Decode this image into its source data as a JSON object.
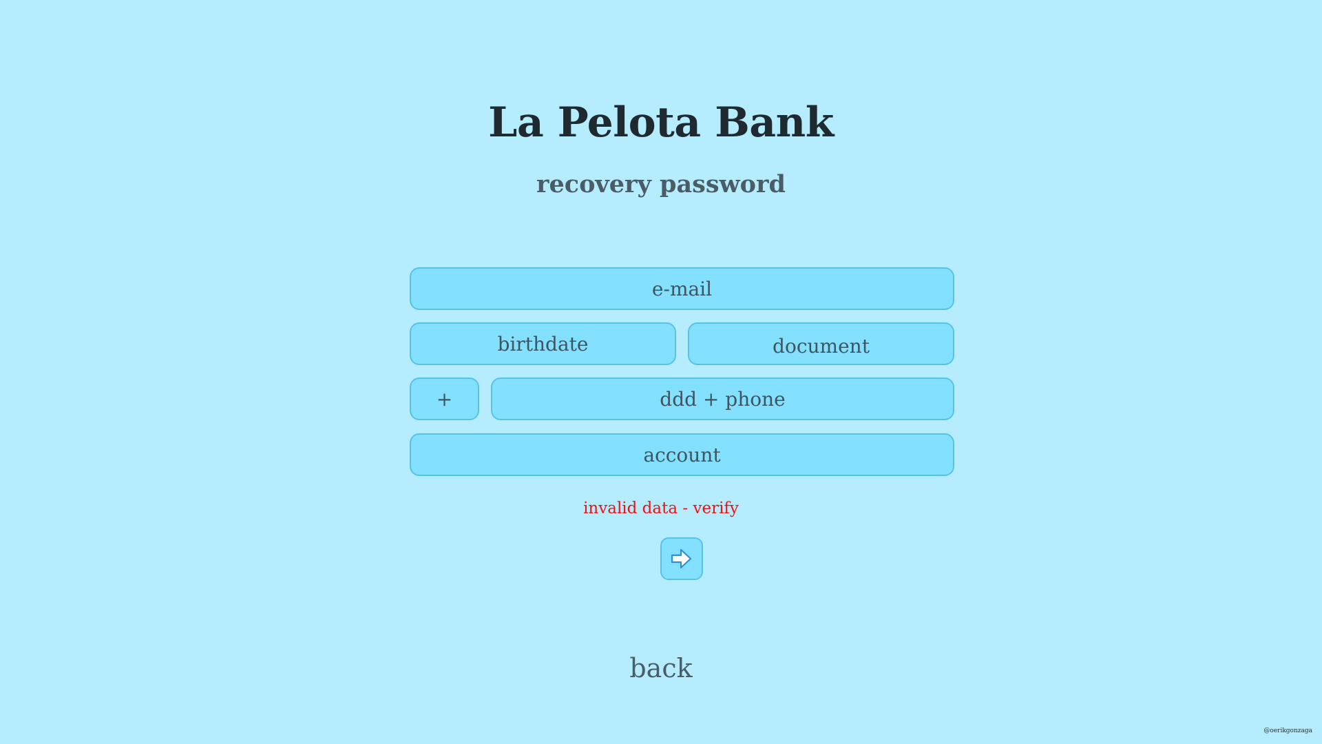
{
  "header": {
    "title": "La Pelota Bank",
    "subtitle": "recovery password"
  },
  "form": {
    "email_placeholder": "e-mail",
    "birthdate_placeholder": "birthdate",
    "document_placeholder": "document",
    "ddi_placeholder": "+",
    "phone_placeholder": "ddd + phone",
    "account_placeholder": "account",
    "error_message": "invalid data - verify",
    "submit_icon": "arrow-right-icon"
  },
  "footer": {
    "back_label": "back",
    "credit": "@oerikgonzaga"
  },
  "colors": {
    "background": "#b5edff",
    "field_fill": "#84e0ff",
    "field_border": "#57c1ee",
    "error": "#ee1111",
    "title": "#1f2a30"
  }
}
